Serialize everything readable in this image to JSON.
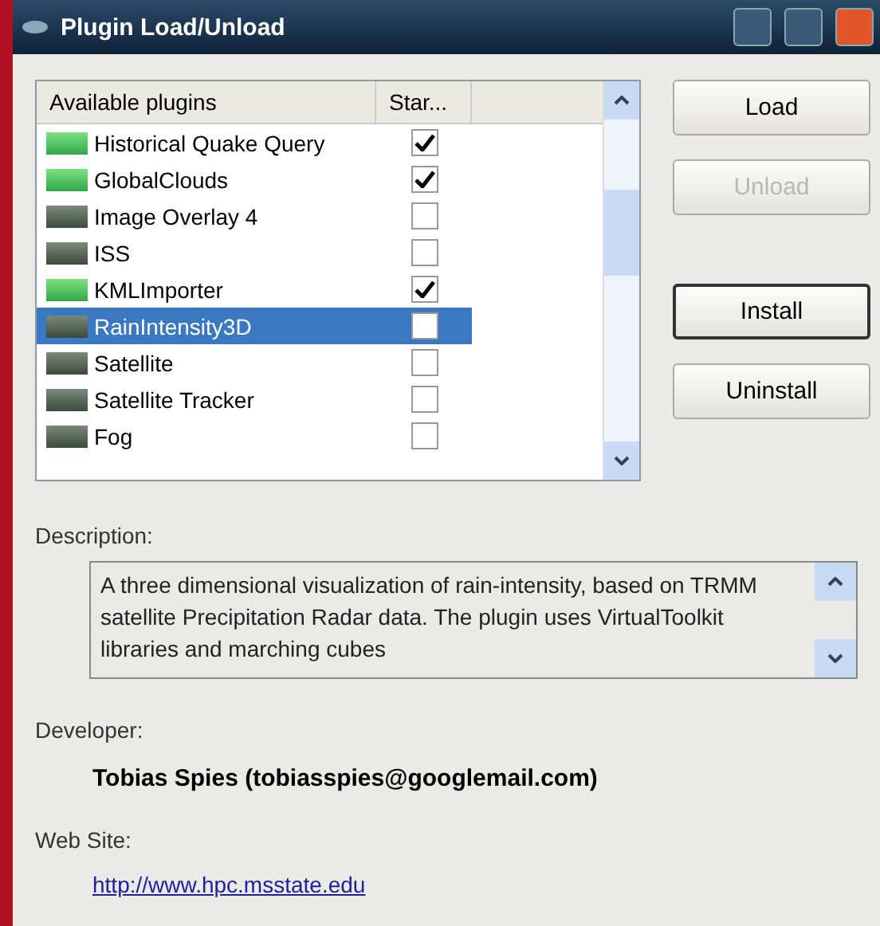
{
  "window": {
    "title": "Plugin Load/Unload"
  },
  "list": {
    "columns": [
      "Available plugins",
      "Star..."
    ],
    "rows": [
      {
        "name": "Historical Quake Query",
        "loaded": true,
        "checked": true,
        "selected": false
      },
      {
        "name": "GlobalClouds",
        "loaded": true,
        "checked": true,
        "selected": false
      },
      {
        "name": "Image Overlay 4",
        "loaded": false,
        "checked": false,
        "selected": false
      },
      {
        "name": "ISS",
        "loaded": false,
        "checked": false,
        "selected": false
      },
      {
        "name": "KMLImporter",
        "loaded": true,
        "checked": true,
        "selected": false
      },
      {
        "name": "RainIntensity3D",
        "loaded": false,
        "checked": false,
        "selected": true
      },
      {
        "name": "Satellite",
        "loaded": false,
        "checked": false,
        "selected": false
      },
      {
        "name": "Satellite Tracker",
        "loaded": false,
        "checked": false,
        "selected": false
      },
      {
        "name": "Fog",
        "loaded": false,
        "checked": false,
        "selected": false
      }
    ]
  },
  "buttons": [
    {
      "label": "Load",
      "disabled": false,
      "default": false
    },
    {
      "label": "Unload",
      "disabled": true,
      "default": false
    },
    {
      "label": "Install",
      "disabled": false,
      "default": true
    },
    {
      "label": "Uninstall",
      "disabled": false,
      "default": false
    }
  ],
  "description": {
    "label": "Description:",
    "text": "A three dimensional visualization of rain-intensity, based on TRMM satellite Precipitation Radar data. The plugin uses VirtualToolkit libraries and marching cubes"
  },
  "developer": {
    "label": "Developer:",
    "value": "Tobias Spies (tobiasspies@googlemail.com)"
  },
  "website": {
    "label": "Web Site:",
    "value": "http://www.hpc.msstate.edu"
  }
}
